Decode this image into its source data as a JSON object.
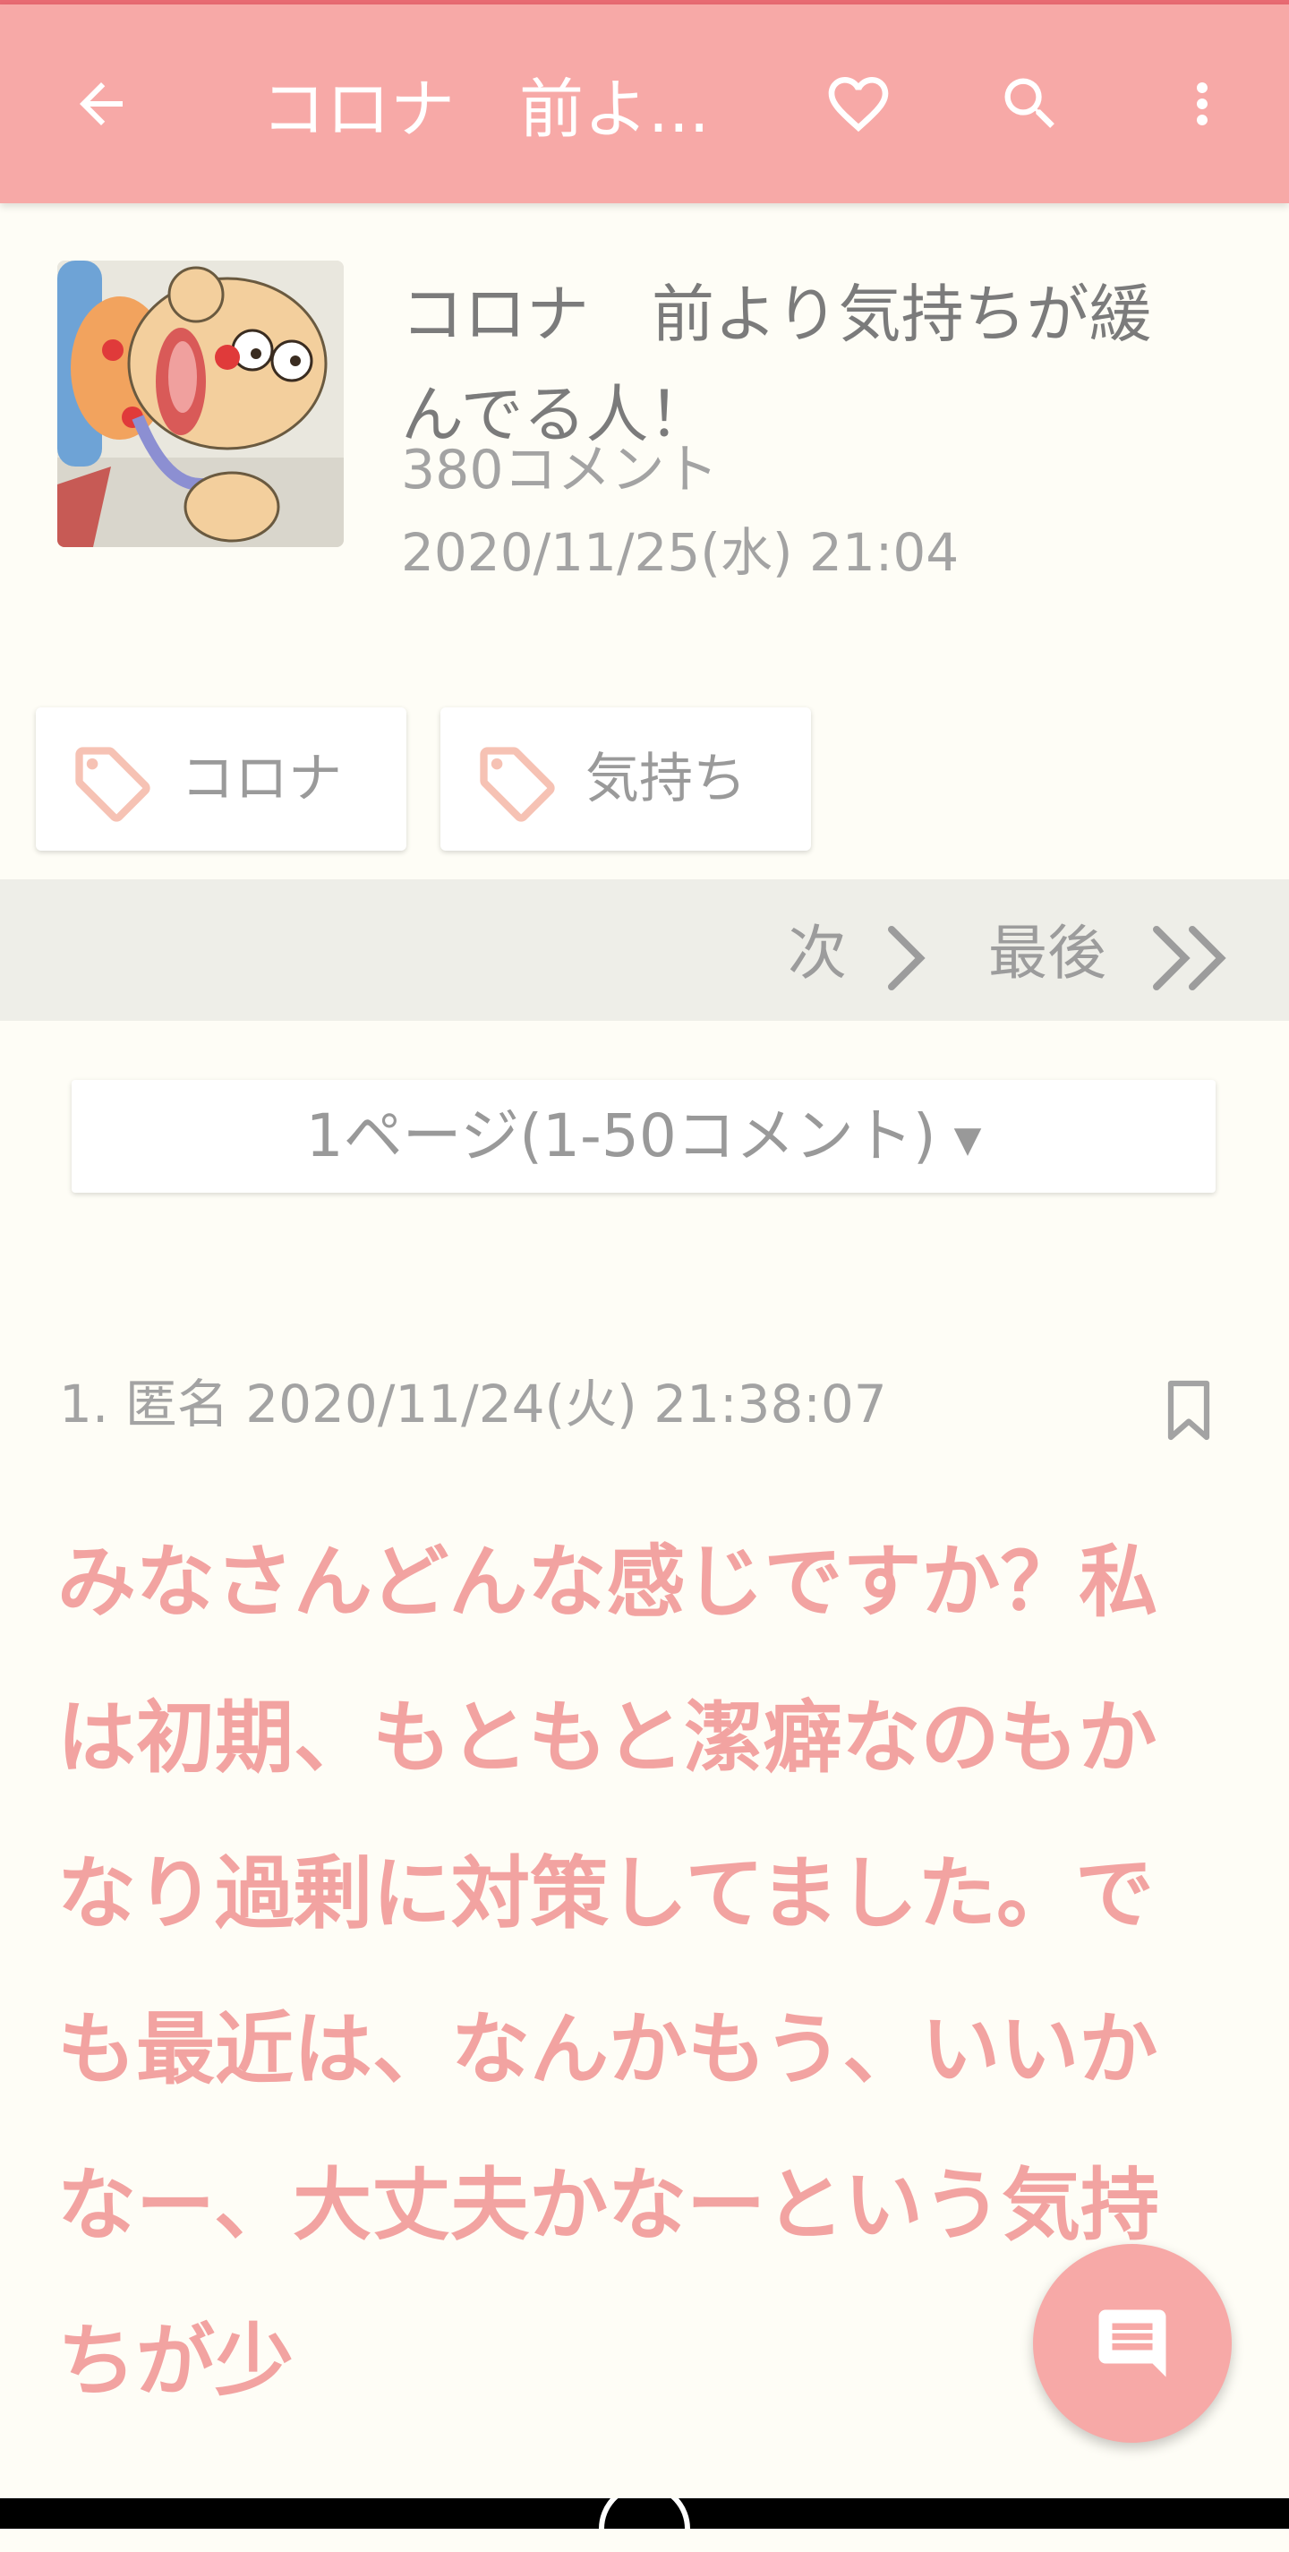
{
  "app_bar": {
    "title": "コロナ　前よ...",
    "back_icon": "arrow-left-icon",
    "favorite_icon": "heart-outline-icon",
    "search_icon": "search-icon",
    "menu_icon": "more-vert-icon",
    "bar_color": "#f7a9a7"
  },
  "topic": {
    "title": "コロナ　前より気持ちが緩んでる人！",
    "comment_count": "380コメント",
    "date": "2020/11/25(水) 21:04",
    "thumbnail": "cartoon-character-thumbnail"
  },
  "tags": [
    {
      "label": "コロナ",
      "icon": "tag-icon"
    },
    {
      "label": "気持ち",
      "icon": "tag-icon"
    }
  ],
  "pager": {
    "next_label": "次",
    "last_label": "最後"
  },
  "page_select": {
    "selected": "1ページ(1-50コメント)",
    "caret": "▼"
  },
  "comment": {
    "meta": "1. 匿名 2020/11/24(火) 21:38:07",
    "body": "みなさんどんな感じですか？私は初期、もともと潔癖なのもかなり過剰に対策してました。でも最近は、なんかもう、いいかなー、大丈夫かなーという気持ちが少",
    "text_color": "#f2a3a1"
  },
  "fab": {
    "icon": "comment-icon"
  }
}
